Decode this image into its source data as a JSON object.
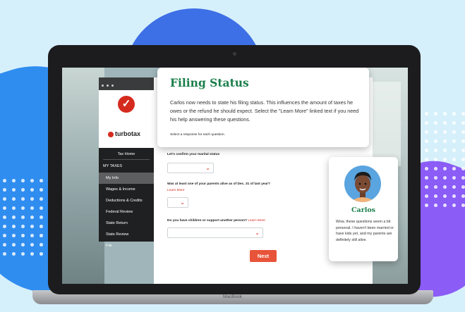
{
  "device": {
    "label": "MacBook"
  },
  "sidebar": {
    "brand": "turbotax",
    "home": "Tax Home",
    "section_heading": "MY TAXES",
    "items": [
      {
        "label": "My Info",
        "active": true
      },
      {
        "label": "Wages & Income"
      },
      {
        "label": "Deductions & Credits"
      },
      {
        "label": "Federal Review"
      },
      {
        "label": "State Return"
      },
      {
        "label": "State Review"
      },
      {
        "label": "File"
      }
    ]
  },
  "filing_card": {
    "title": "Filing Status",
    "body": "Carlos now needs to state his filing status. This influences the amount of taxes he owes or the refund he should expect. Select the \"Learn More\" linked text if you need his help answering these questions.",
    "hint": "Select a response for each question."
  },
  "questions": [
    {
      "label": "Let's confirm your marital status",
      "link": ""
    },
    {
      "label": "Was at least one of your parents alive as of Dec. 31 of last year?",
      "link": "Learn More"
    },
    {
      "label": "Do you have children or support another person?",
      "link": "Learn More"
    }
  ],
  "next_button": {
    "label": "Next"
  },
  "character": {
    "name": "Carlos",
    "quote": "Wow, these questions seem a bit personal. I haven't been married or have kids yet, and my parents are definitely still alive."
  },
  "colors": {
    "brand_green": "#1a7f4b",
    "brand_red": "#d52b1e",
    "button": "#e8543a"
  }
}
